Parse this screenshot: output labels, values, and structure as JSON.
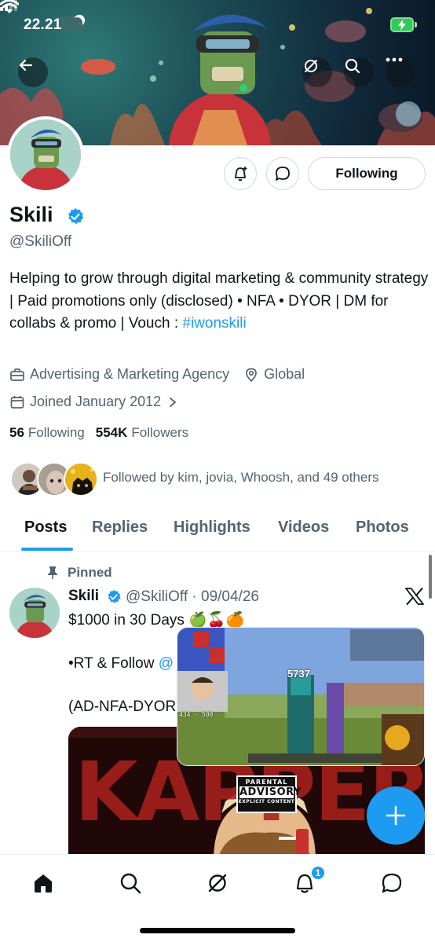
{
  "status_bar": {
    "time": "22.21"
  },
  "header": {
    "back_icon": "arrow-left-icon",
    "grok_icon": "slash-circle-icon",
    "search_icon": "search-icon",
    "more_icon": "more-icon"
  },
  "profile": {
    "name": "Skili",
    "handle": "@SkiliOff",
    "bio_text": "Helping to grow through digital marketing & community strategy | Paid promotions only (disclosed) • NFA • DYOR | DM for collabs & promo | Vouch : ",
    "bio_hashtag": "#iwonskili",
    "category": "Advertising & Marketing Agency",
    "location": "Global",
    "joined": "Joined January 2012",
    "following_count": "56",
    "following_label": "Following",
    "followers_count": "554K",
    "followers_label": "Followers",
    "followed_by": "Followed by kim, jovia, Whoosh, and 49 others",
    "following_button": "Following"
  },
  "tabs": [
    {
      "label": "Posts",
      "active": true
    },
    {
      "label": "Replies",
      "active": false
    },
    {
      "label": "Highlights",
      "active": false
    },
    {
      "label": "Videos",
      "active": false
    },
    {
      "label": "Photos",
      "active": false
    }
  ],
  "post": {
    "pinned_label": "Pinned",
    "name": "Skili",
    "handle_date": "@SkiliOff · 09/04/26",
    "line1": "$1000 in 30 Days 🍏🍒🍊",
    "line2_prefix": "•RT & Follow ",
    "line2_mention": "@",
    "line3": "(AD-NFA-DYOR",
    "media_text": "KAPPER",
    "advisory_top": "PARENTAL",
    "advisory_mid": "ADVISORY",
    "advisory_bottom": "EXPLICIT CONTENT"
  },
  "pip_video": {
    "counter": "5737",
    "score": "434 - 500"
  },
  "bottom_nav": {
    "items": [
      "home-icon",
      "search-icon",
      "grok-icon",
      "notifications-icon",
      "messages-icon"
    ],
    "notification_badge": "1"
  },
  "colors": {
    "accent": "#1d9bf0",
    "text": "#0f1419",
    "secondary": "#536471"
  }
}
